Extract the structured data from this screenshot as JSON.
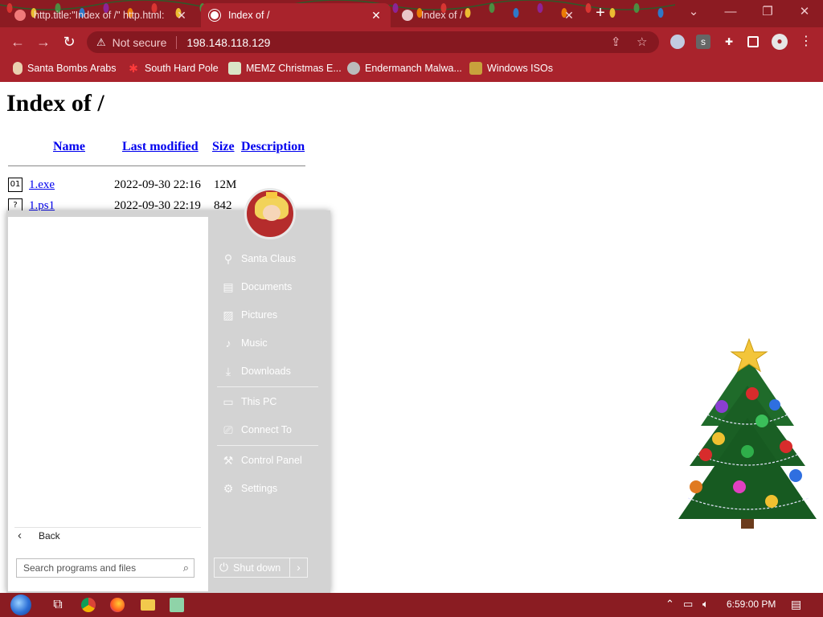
{
  "browser": {
    "tabs": [
      {
        "title": "http.title:\"Index of /\" http.html:",
        "active": false
      },
      {
        "title": "Index of /",
        "active": true
      },
      {
        "title": "Index of /",
        "active": false
      }
    ],
    "new_tab_glyph": "+",
    "window_controls": {
      "dropdown": "⌄",
      "minimize": "—",
      "restore": "❐",
      "close": "✕"
    },
    "address": {
      "security_label": "Not secure",
      "url": "198.148.118.129"
    },
    "bookmarks": [
      {
        "label": "Santa Bombs Arabs",
        "icon": "feather-icon"
      },
      {
        "label": "South Hard Pole",
        "icon": "snowflake-icon"
      },
      {
        "label": "MEMZ Christmas E...",
        "icon": "image-icon"
      },
      {
        "label": "Endermanch Malwa...",
        "icon": "mask-icon"
      },
      {
        "label": "Windows ISOs",
        "icon": "gift-icon"
      }
    ]
  },
  "page": {
    "heading": "Index of /",
    "columns": {
      "name": "Name",
      "last_modified": "Last modified",
      "size": "Size",
      "description": "Description"
    },
    "files": [
      {
        "name": "1.exe",
        "modified": "2022-09-30 22:16",
        "size": "12M",
        "icon": "binary-file-icon"
      },
      {
        "name": "1.ps1",
        "modified": "2022-09-30 22:19",
        "size": "842",
        "icon": "unknown-file-icon"
      }
    ]
  },
  "start_menu": {
    "items": [
      {
        "label": "Santa Claus",
        "icon": "user-folder-icon"
      },
      {
        "label": "Documents",
        "icon": "document-icon"
      },
      {
        "label": "Pictures",
        "icon": "picture-icon"
      },
      {
        "label": "Music",
        "icon": "music-note-icon"
      },
      {
        "label": "Downloads",
        "icon": "download-icon"
      },
      {
        "label": "This PC",
        "icon": "computer-icon"
      },
      {
        "label": "Connect To",
        "icon": "connect-icon"
      },
      {
        "label": "Control Panel",
        "icon": "wrench-icon"
      },
      {
        "label": "Settings",
        "icon": "gear-icon"
      }
    ],
    "back_label": "Back",
    "search_placeholder": "Search programs and files",
    "shutdown_label": "Shut down"
  },
  "taskbar": {
    "clock": "6:59:00 PM",
    "apps": [
      "start-orb",
      "task-view",
      "chrome",
      "firefox",
      "file-explorer",
      "notepad"
    ]
  }
}
